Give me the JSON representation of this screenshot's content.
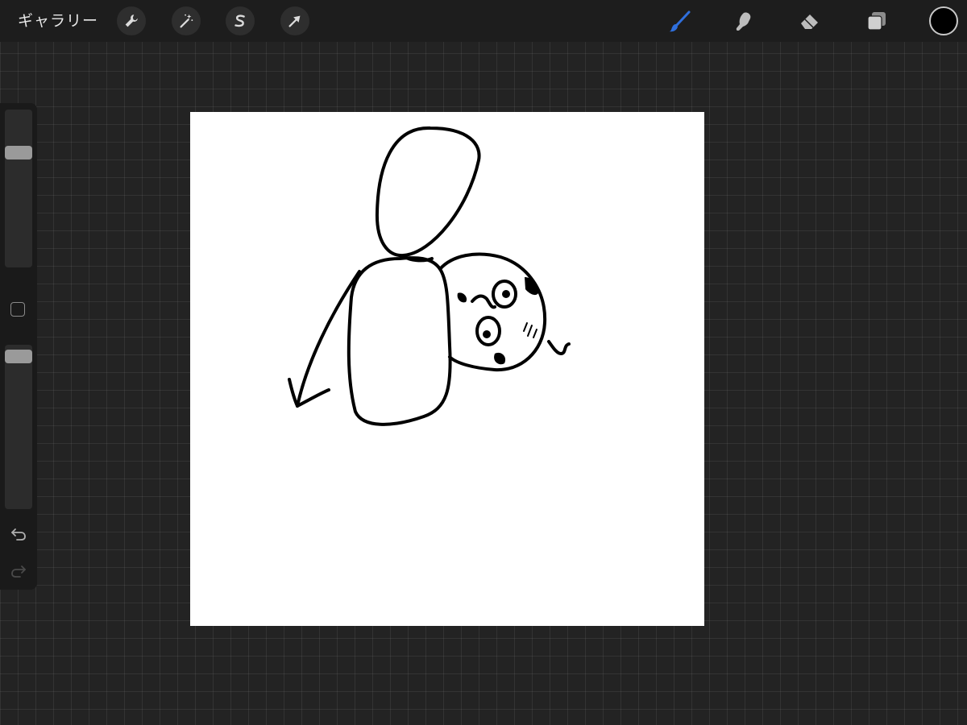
{
  "topbar": {
    "gallery_label": "ギャラリー",
    "left_tools": [
      "wrench-icon",
      "magic-wand-icon",
      "selection-s-icon",
      "transform-arrow-icon"
    ],
    "right_tools": [
      "brush-icon",
      "smudge-icon",
      "eraser-icon",
      "layers-icon"
    ],
    "active_tool": "brush",
    "active_color": "#2f6fdc",
    "current_color": "#000000"
  },
  "sidebar": {
    "brush_size_level": 0.12,
    "opacity_level": 0.05,
    "icons": [
      "undo-icon",
      "redo-icon"
    ]
  },
  "canvas": {
    "background": "#ffffff",
    "stroke_color": "#000000"
  }
}
